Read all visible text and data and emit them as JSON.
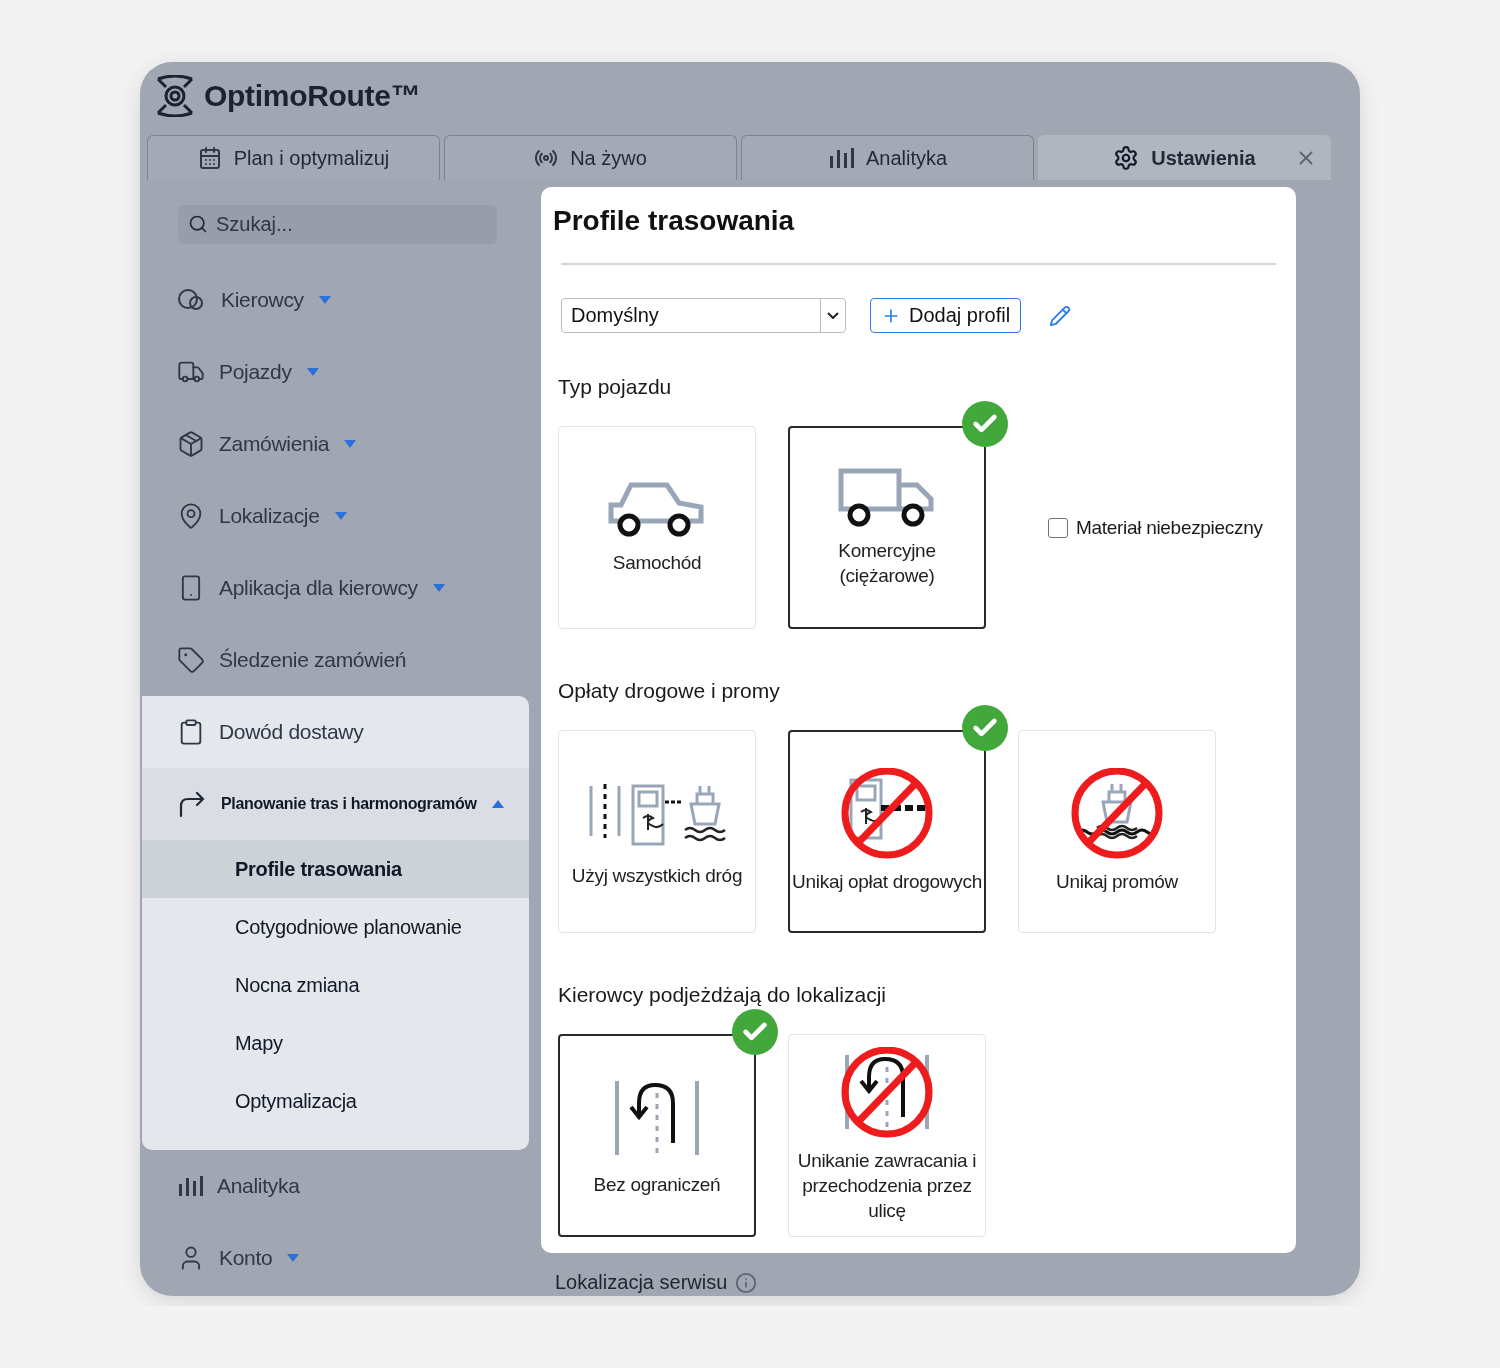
{
  "app": {
    "logo": "OptimoRoute™"
  },
  "tabs": [
    {
      "label": "Plan i optymalizuj",
      "selected": false
    },
    {
      "label": "Na żywo",
      "selected": false
    },
    {
      "label": "Analityka",
      "selected": false
    },
    {
      "label": "Ustawienia",
      "selected": true
    }
  ],
  "sidebar": {
    "search": {
      "placeholder": "Szukaj..."
    },
    "sections": [
      {
        "highlighted": false,
        "items": [
          {
            "label": "Kierowcy",
            "expanded": false
          },
          {
            "label": "Pojazdy",
            "expanded": false
          },
          {
            "label": "Zamówienia",
            "expanded": false
          },
          {
            "label": "Lokalizacje",
            "expanded": false
          },
          {
            "label": "Aplikacja dla kierowcy",
            "expanded": false
          },
          {
            "label": "Śledzenie zamówień"
          }
        ]
      },
      {
        "highlighted": true,
        "items": [
          {
            "label": "Dowód dostawy"
          },
          {
            "label": "Planowanie tras i harmonogramów",
            "expanded": true,
            "children": [
              {
                "label": "Profile trasowania",
                "selected": true
              },
              {
                "label": "Cotygodniowe planowanie",
                "selected": false
              },
              {
                "label": "Nocna zmiana",
                "selected": false
              },
              {
                "label": "Mapy",
                "selected": false
              },
              {
                "label": "Optymalizacja",
                "selected": false
              }
            ]
          }
        ]
      },
      {
        "highlighted": false,
        "items": [
          {
            "label": "Analityka"
          },
          {
            "label": "Konto",
            "expanded": false
          }
        ]
      }
    ]
  },
  "panel": {
    "title": "Profile trasowania",
    "profile": "Domyślny",
    "add_button": "Dodaj profil",
    "groups": [
      {
        "title": "Typ pojazdu",
        "options": [
          {
            "label": "Samochód",
            "selected": false
          },
          {
            "label": "Komercyjne (ciężarowe)",
            "selected": true
          }
        ],
        "checkbox": {
          "label": "Materiał niebezpieczny",
          "checked": false
        }
      },
      {
        "title": "Opłaty drogowe i promy",
        "options": [
          {
            "label": "Użyj wszystkich dróg",
            "selected": false
          },
          {
            "label": "Unikaj opłat drogowych",
            "selected": true
          },
          {
            "label": "Unikaj promów",
            "selected": false
          }
        ]
      },
      {
        "title": "Kierowcy podjeżdżają do lokalizacji",
        "options": [
          {
            "label": "Bez ograniczeń",
            "selected": true
          },
          {
            "label": "Unikanie zawracania i przechodzenia przez ulicę",
            "selected": false
          }
        ]
      }
    ]
  },
  "footer": {
    "label": "Lokalizacja serwisu"
  }
}
